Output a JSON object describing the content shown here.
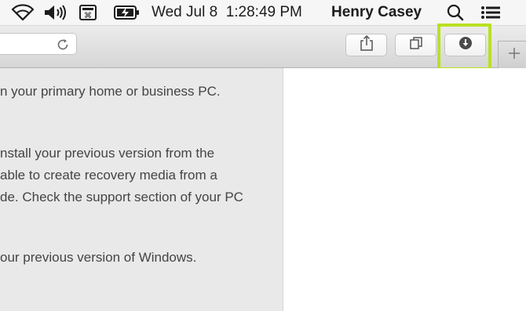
{
  "menubar": {
    "icons": [
      "wifi-icon",
      "volume-icon",
      "command-icon",
      "battery-charging-icon"
    ],
    "datetime": "Wed Jul 8  1:28:49 PM",
    "user": "Henry Casey",
    "right_icons": [
      "spotlight-search-icon",
      "notification-center-icon"
    ]
  },
  "toolbar": {
    "buttons": [
      "share-icon",
      "show-all-tabs-icon",
      "downloads-icon"
    ],
    "reload_icon": "reload-icon",
    "new_tab_icon": "plus-icon",
    "highlight_color": "#b9e023"
  },
  "content": {
    "lines": [
      "n your primary home or business PC.",
      "nstall your previous version from the",
      "able to create recovery media from a",
      "de. Check the support section of your PC",
      "our previous version of Windows."
    ]
  }
}
